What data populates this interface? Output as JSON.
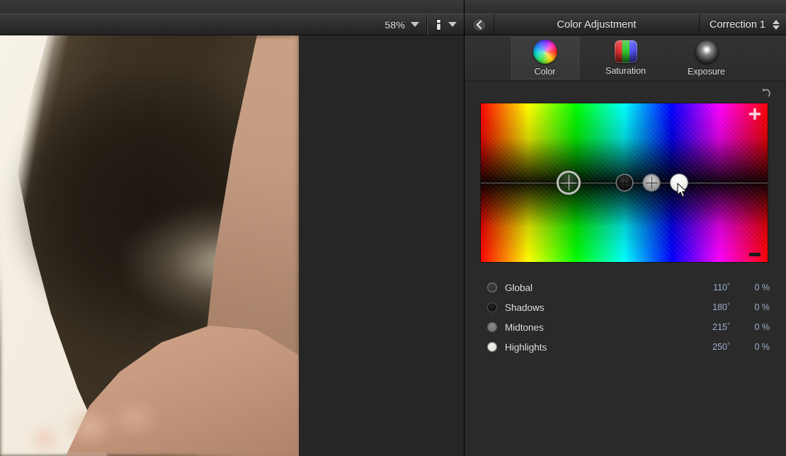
{
  "viewer": {
    "zoom_level": "58%",
    "zoom_caret_icon": "caret-down-icon",
    "view_mode_icon": "split-view-icon",
    "view_caret_icon": "caret-down-icon",
    "window_resize_icon": "window-resize-icon"
  },
  "inspector": {
    "back_icon": "back-chevron-icon",
    "title": "Color Adjustment",
    "correction_label": "Correction 1",
    "stepper_icon": "up-down-stepper-icon",
    "reset_icon": "reset-arrow-icon",
    "tabs": [
      {
        "label": "Color",
        "icon": "color-wheel-icon",
        "selected": true
      },
      {
        "label": "Saturation",
        "icon": "saturation-bars-icon",
        "selected": false
      },
      {
        "label": "Exposure",
        "icon": "exposure-sphere-icon",
        "selected": false
      }
    ],
    "color_board": {
      "add_icon": "plus-icon",
      "remove_icon": "minus-icon",
      "pucks": [
        {
          "name": "global",
          "x_pct": 30.6
        },
        {
          "name": "shadows",
          "x_pct": 50.1
        },
        {
          "name": "midtones",
          "x_pct": 59.5
        },
        {
          "name": "highlights",
          "x_pct": 69.1
        }
      ]
    },
    "parameters": [
      {
        "name": "Global",
        "angle": "110",
        "degree_symbol": "°",
        "percent": "0 %"
      },
      {
        "name": "Shadows",
        "angle": "180",
        "degree_symbol": "°",
        "percent": "0 %"
      },
      {
        "name": "Midtones",
        "angle": "215",
        "degree_symbol": "°",
        "percent": "0 %"
      },
      {
        "name": "Highlights",
        "angle": "250",
        "degree_symbol": "°",
        "percent": "0 %"
      }
    ]
  },
  "colors": {
    "panel_bg": "#2a2a2a",
    "toolbar_bg": "#2e2e2e",
    "text": "#e6e6e6",
    "value_text": "#9db0cc",
    "board_border": "#151515"
  }
}
